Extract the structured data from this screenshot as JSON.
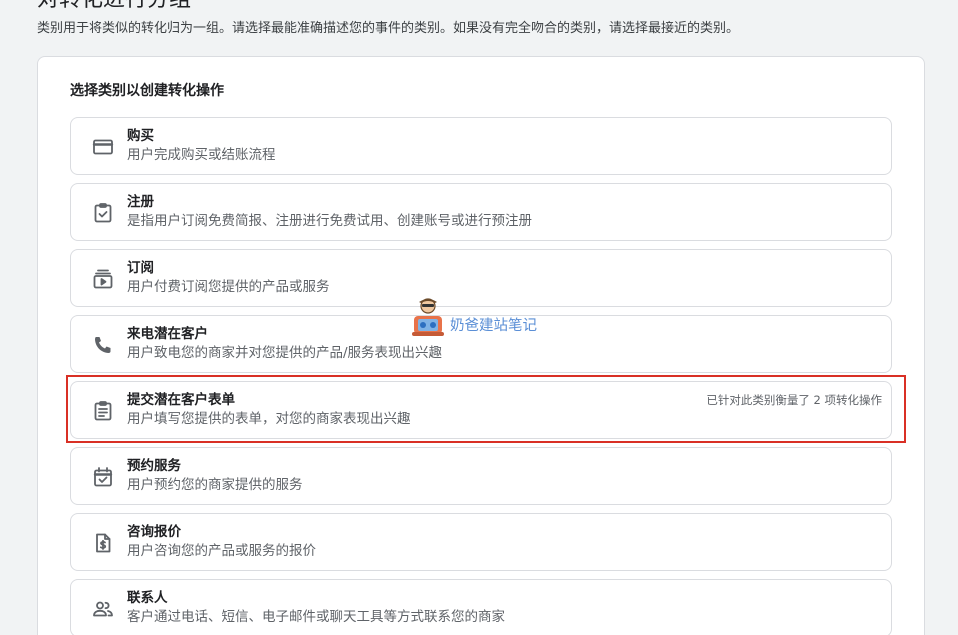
{
  "page": {
    "title": "对转化进行分组",
    "description": "类别用于将类似的转化归为一组。请选择最能准确描述您的事件的类别。如果没有完全吻合的类别，请选择最接近的类别。"
  },
  "section": {
    "title": "选择类别以创建转化操作"
  },
  "categories": [
    {
      "icon": "credit-card-icon",
      "title": "购买",
      "description": "用户完成购买或结账流程",
      "badge": ""
    },
    {
      "icon": "clipboard-check-icon",
      "title": "注册",
      "description": "是指用户订阅免费简报、注册进行免费试用、创建账号或进行预注册",
      "badge": ""
    },
    {
      "icon": "subscriptions-icon",
      "title": "订阅",
      "description": "用户付费订阅您提供的产品或服务",
      "badge": ""
    },
    {
      "icon": "phone-icon",
      "title": "来电潜在客户",
      "description": "用户致电您的商家并对您提供的产品/服务表现出兴趣",
      "badge": ""
    },
    {
      "icon": "form-icon",
      "title": "提交潜在客户表单",
      "description": "用户填写您提供的表单，对您的商家表现出兴趣",
      "badge": "已针对此类别衡量了 2 项转化操作"
    },
    {
      "icon": "calendar-check-icon",
      "title": "预约服务",
      "description": "用户预约您的商家提供的服务",
      "badge": ""
    },
    {
      "icon": "request-quote-icon",
      "title": "咨询报价",
      "description": "用户咨询您的产品或服务的报价",
      "badge": ""
    },
    {
      "icon": "contacts-icon",
      "title": "联系人",
      "description": "客户通过电话、短信、电子邮件或聊天工具等方式联系您的商家",
      "badge": ""
    }
  ],
  "watermark": {
    "text": "奶爸建站笔记"
  },
  "colors": {
    "highlight": "#d93025",
    "border": "#dadce0",
    "icon": "#5f6368",
    "watermark": "#5b8fd6"
  }
}
